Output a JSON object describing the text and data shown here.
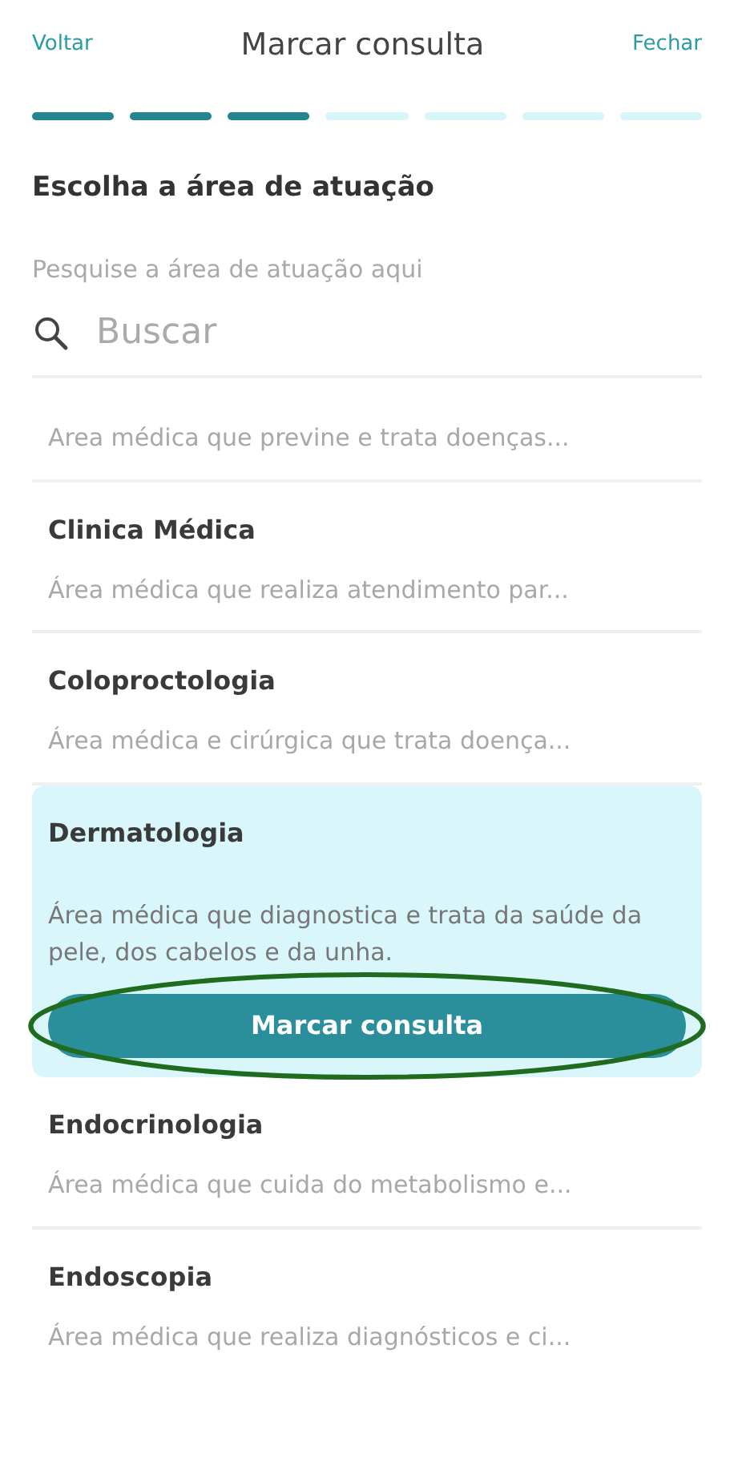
{
  "header": {
    "back": "Voltar",
    "title": "Marcar consulta",
    "close": "Fechar"
  },
  "steps": [
    {
      "done": true
    },
    {
      "done": true
    },
    {
      "done": true
    },
    {
      "done": false
    },
    {
      "done": false
    },
    {
      "done": false
    },
    {
      "done": false
    }
  ],
  "heading": "Escolha a área de atuação",
  "search": {
    "label": "Pesquise a área de atuação aqui",
    "placeholder": "Buscar"
  },
  "items": [
    {
      "description": "Area médica que previne e trata doenças...",
      "expanded": false
    },
    {
      "title": "Clinica Médica",
      "description": "Área médica que realiza atendimento par...",
      "expanded": false
    },
    {
      "title": "Coloproctologia",
      "description": "Área médica e cirúrgica que trata doença...",
      "expanded": false
    },
    {
      "title": "Dermatologia",
      "description": "Área médica que diagnostica e trata da saúde da pele, dos cabelos e da unha.",
      "expanded": true,
      "button": {
        "label": "Marcar consulta",
        "circled": true
      }
    },
    {
      "title": "Endocrinologia",
      "description": "Área médica que cuida do metabolismo e...",
      "expanded": false
    },
    {
      "title": "Endoscopia",
      "description": "Área médica que realiza diagnósticos e ci...",
      "expanded": false
    }
  ]
}
